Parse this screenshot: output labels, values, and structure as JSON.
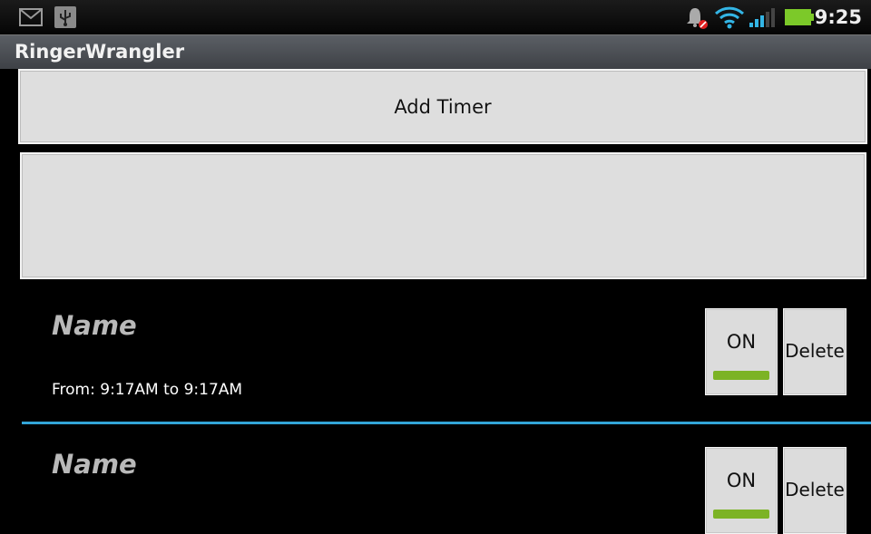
{
  "status_bar": {
    "time": "9:25",
    "icons": [
      "gmail-icon",
      "usb-icon",
      "ringer-muted-icon",
      "wifi-icon",
      "signal-icon",
      "battery-icon"
    ],
    "battery_color": "#7cc929",
    "wifi_color": "#33b5e5"
  },
  "app": {
    "title": "RingerWrangler"
  },
  "add_timer": {
    "label": "Add Timer"
  },
  "timers": [
    {
      "name": "Name",
      "range": "From: 9:17AM to 9:17AM",
      "toggle_label": "ON",
      "delete_label": "Delete",
      "toggle_on": true
    },
    {
      "name": "Name",
      "range": "",
      "toggle_label": "ON",
      "delete_label": "Delete",
      "toggle_on": true
    }
  ],
  "colors": {
    "accent_divider": "#33a5d8",
    "toggle_on": "#7cb325"
  }
}
